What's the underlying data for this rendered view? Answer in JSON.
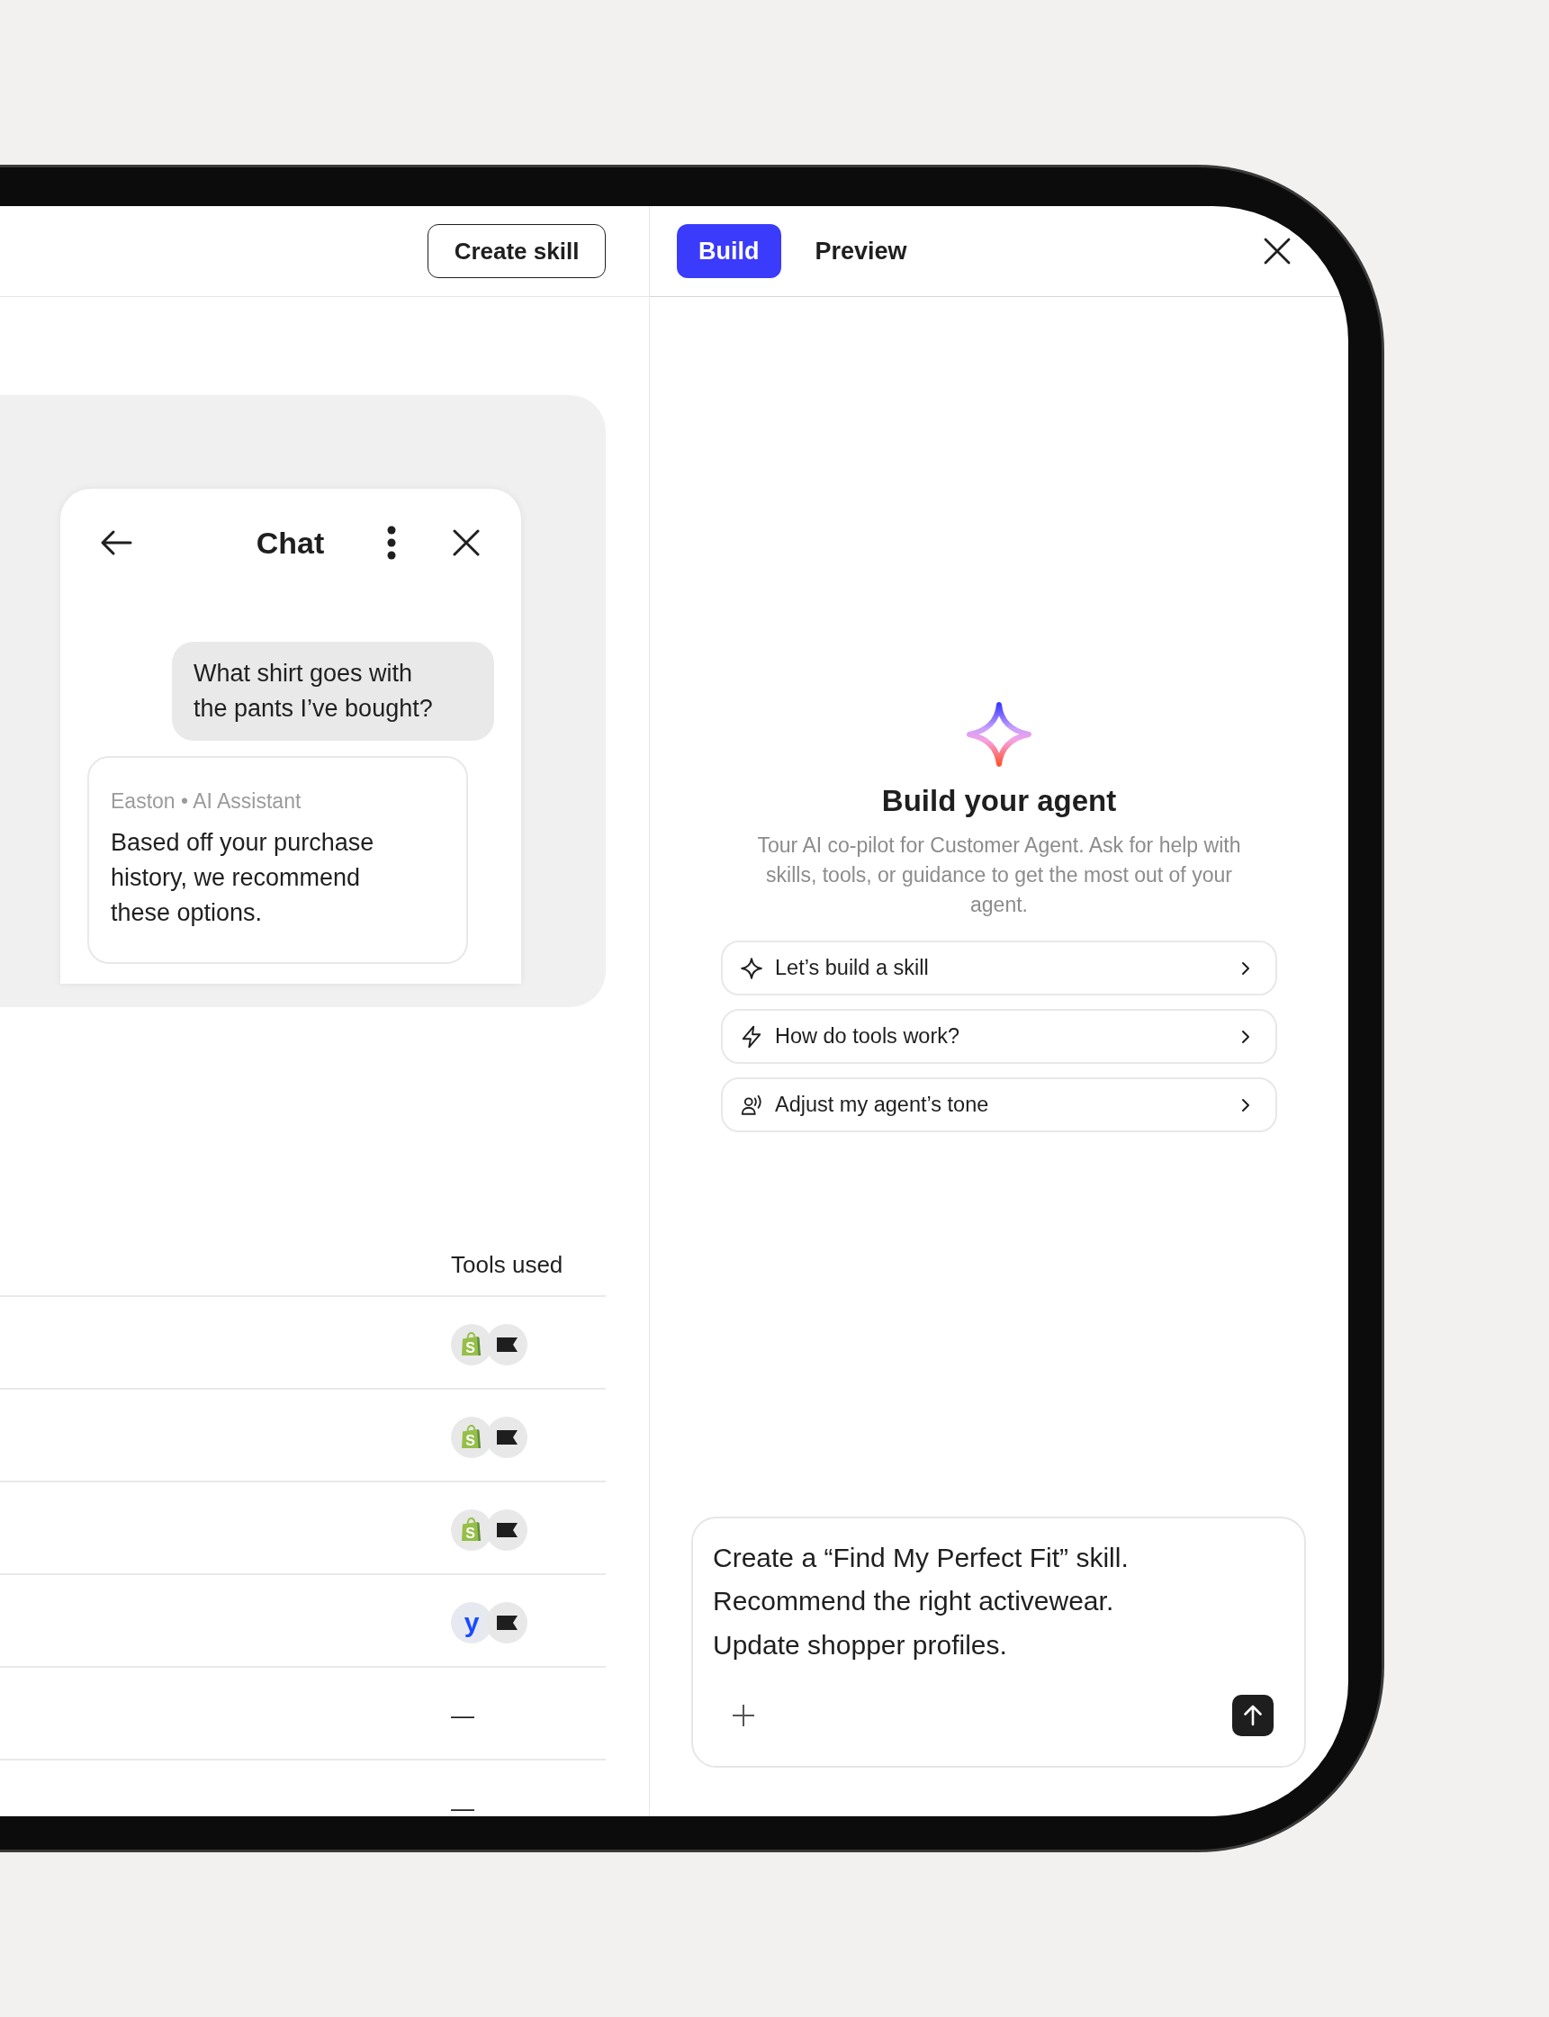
{
  "left_pane": {
    "create_skill_button": "Create skill",
    "chat_preview": {
      "title": "Chat",
      "messages": [
        {
          "kind": "user",
          "text": "What shirt goes with the pants I’ve bought?"
        },
        {
          "kind": "assistant",
          "meta": "Easton • AI Assistant",
          "text": "Based off your purchase history, we recommend these options."
        }
      ]
    },
    "table": {
      "columns": [
        {
          "label": "Tools used"
        }
      ],
      "rows": [
        {
          "kind": "tools",
          "tools": [
            {
              "kind": "bag",
              "glyph": "S"
            },
            {
              "kind": "flag"
            }
          ]
        },
        {
          "kind": "tools",
          "tools": [
            {
              "kind": "bag",
              "glyph": "S"
            },
            {
              "kind": "flag"
            }
          ]
        },
        {
          "kind": "tools",
          "tools": [
            {
              "kind": "bag",
              "glyph": "S"
            },
            {
              "kind": "flag"
            }
          ]
        },
        {
          "kind": "tools",
          "tools": [
            {
              "kind": "letter",
              "glyph": "y"
            },
            {
              "kind": "flag"
            }
          ]
        },
        {
          "kind": "empty",
          "text": "—"
        },
        {
          "kind": "empty",
          "text": "—"
        }
      ]
    }
  },
  "right_pane": {
    "tabs": [
      {
        "label": "Build",
        "selected": true
      },
      {
        "label": "Preview",
        "selected": false
      }
    ],
    "title": "Build your agent",
    "description": "Tour AI co-pilot for Customer Agent. Ask for help with skills, tools, or guidance to get the most out of your agent.",
    "suggestions": [
      {
        "kind": "sparkle",
        "label": "Let’s build a skill"
      },
      {
        "kind": "bolt",
        "label": "How do tools work?"
      },
      {
        "kind": "voice",
        "label": "Adjust my agent’s tone"
      }
    ],
    "composer": {
      "value": "Create a “Find My Perfect Fit” skill.\nRecommend the right activewear.\nUpdate shopper profiles."
    }
  }
}
